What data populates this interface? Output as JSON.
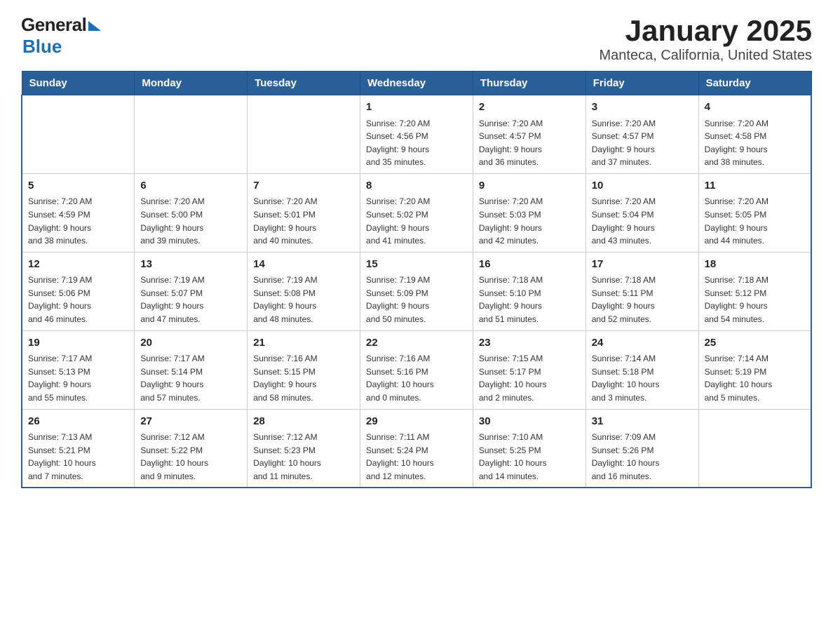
{
  "header": {
    "logo": {
      "general": "General",
      "blue": "Blue"
    },
    "title": "January 2025",
    "subtitle": "Manteca, California, United States"
  },
  "calendar": {
    "weekdays": [
      "Sunday",
      "Monday",
      "Tuesday",
      "Wednesday",
      "Thursday",
      "Friday",
      "Saturday"
    ],
    "weeks": [
      [
        {
          "day": "",
          "info": ""
        },
        {
          "day": "",
          "info": ""
        },
        {
          "day": "",
          "info": ""
        },
        {
          "day": "1",
          "info": "Sunrise: 7:20 AM\nSunset: 4:56 PM\nDaylight: 9 hours\nand 35 minutes."
        },
        {
          "day": "2",
          "info": "Sunrise: 7:20 AM\nSunset: 4:57 PM\nDaylight: 9 hours\nand 36 minutes."
        },
        {
          "day": "3",
          "info": "Sunrise: 7:20 AM\nSunset: 4:57 PM\nDaylight: 9 hours\nand 37 minutes."
        },
        {
          "day": "4",
          "info": "Sunrise: 7:20 AM\nSunset: 4:58 PM\nDaylight: 9 hours\nand 38 minutes."
        }
      ],
      [
        {
          "day": "5",
          "info": "Sunrise: 7:20 AM\nSunset: 4:59 PM\nDaylight: 9 hours\nand 38 minutes."
        },
        {
          "day": "6",
          "info": "Sunrise: 7:20 AM\nSunset: 5:00 PM\nDaylight: 9 hours\nand 39 minutes."
        },
        {
          "day": "7",
          "info": "Sunrise: 7:20 AM\nSunset: 5:01 PM\nDaylight: 9 hours\nand 40 minutes."
        },
        {
          "day": "8",
          "info": "Sunrise: 7:20 AM\nSunset: 5:02 PM\nDaylight: 9 hours\nand 41 minutes."
        },
        {
          "day": "9",
          "info": "Sunrise: 7:20 AM\nSunset: 5:03 PM\nDaylight: 9 hours\nand 42 minutes."
        },
        {
          "day": "10",
          "info": "Sunrise: 7:20 AM\nSunset: 5:04 PM\nDaylight: 9 hours\nand 43 minutes."
        },
        {
          "day": "11",
          "info": "Sunrise: 7:20 AM\nSunset: 5:05 PM\nDaylight: 9 hours\nand 44 minutes."
        }
      ],
      [
        {
          "day": "12",
          "info": "Sunrise: 7:19 AM\nSunset: 5:06 PM\nDaylight: 9 hours\nand 46 minutes."
        },
        {
          "day": "13",
          "info": "Sunrise: 7:19 AM\nSunset: 5:07 PM\nDaylight: 9 hours\nand 47 minutes."
        },
        {
          "day": "14",
          "info": "Sunrise: 7:19 AM\nSunset: 5:08 PM\nDaylight: 9 hours\nand 48 minutes."
        },
        {
          "day": "15",
          "info": "Sunrise: 7:19 AM\nSunset: 5:09 PM\nDaylight: 9 hours\nand 50 minutes."
        },
        {
          "day": "16",
          "info": "Sunrise: 7:18 AM\nSunset: 5:10 PM\nDaylight: 9 hours\nand 51 minutes."
        },
        {
          "day": "17",
          "info": "Sunrise: 7:18 AM\nSunset: 5:11 PM\nDaylight: 9 hours\nand 52 minutes."
        },
        {
          "day": "18",
          "info": "Sunrise: 7:18 AM\nSunset: 5:12 PM\nDaylight: 9 hours\nand 54 minutes."
        }
      ],
      [
        {
          "day": "19",
          "info": "Sunrise: 7:17 AM\nSunset: 5:13 PM\nDaylight: 9 hours\nand 55 minutes."
        },
        {
          "day": "20",
          "info": "Sunrise: 7:17 AM\nSunset: 5:14 PM\nDaylight: 9 hours\nand 57 minutes."
        },
        {
          "day": "21",
          "info": "Sunrise: 7:16 AM\nSunset: 5:15 PM\nDaylight: 9 hours\nand 58 minutes."
        },
        {
          "day": "22",
          "info": "Sunrise: 7:16 AM\nSunset: 5:16 PM\nDaylight: 10 hours\nand 0 minutes."
        },
        {
          "day": "23",
          "info": "Sunrise: 7:15 AM\nSunset: 5:17 PM\nDaylight: 10 hours\nand 2 minutes."
        },
        {
          "day": "24",
          "info": "Sunrise: 7:14 AM\nSunset: 5:18 PM\nDaylight: 10 hours\nand 3 minutes."
        },
        {
          "day": "25",
          "info": "Sunrise: 7:14 AM\nSunset: 5:19 PM\nDaylight: 10 hours\nand 5 minutes."
        }
      ],
      [
        {
          "day": "26",
          "info": "Sunrise: 7:13 AM\nSunset: 5:21 PM\nDaylight: 10 hours\nand 7 minutes."
        },
        {
          "day": "27",
          "info": "Sunrise: 7:12 AM\nSunset: 5:22 PM\nDaylight: 10 hours\nand 9 minutes."
        },
        {
          "day": "28",
          "info": "Sunrise: 7:12 AM\nSunset: 5:23 PM\nDaylight: 10 hours\nand 11 minutes."
        },
        {
          "day": "29",
          "info": "Sunrise: 7:11 AM\nSunset: 5:24 PM\nDaylight: 10 hours\nand 12 minutes."
        },
        {
          "day": "30",
          "info": "Sunrise: 7:10 AM\nSunset: 5:25 PM\nDaylight: 10 hours\nand 14 minutes."
        },
        {
          "day": "31",
          "info": "Sunrise: 7:09 AM\nSunset: 5:26 PM\nDaylight: 10 hours\nand 16 minutes."
        },
        {
          "day": "",
          "info": ""
        }
      ]
    ]
  }
}
